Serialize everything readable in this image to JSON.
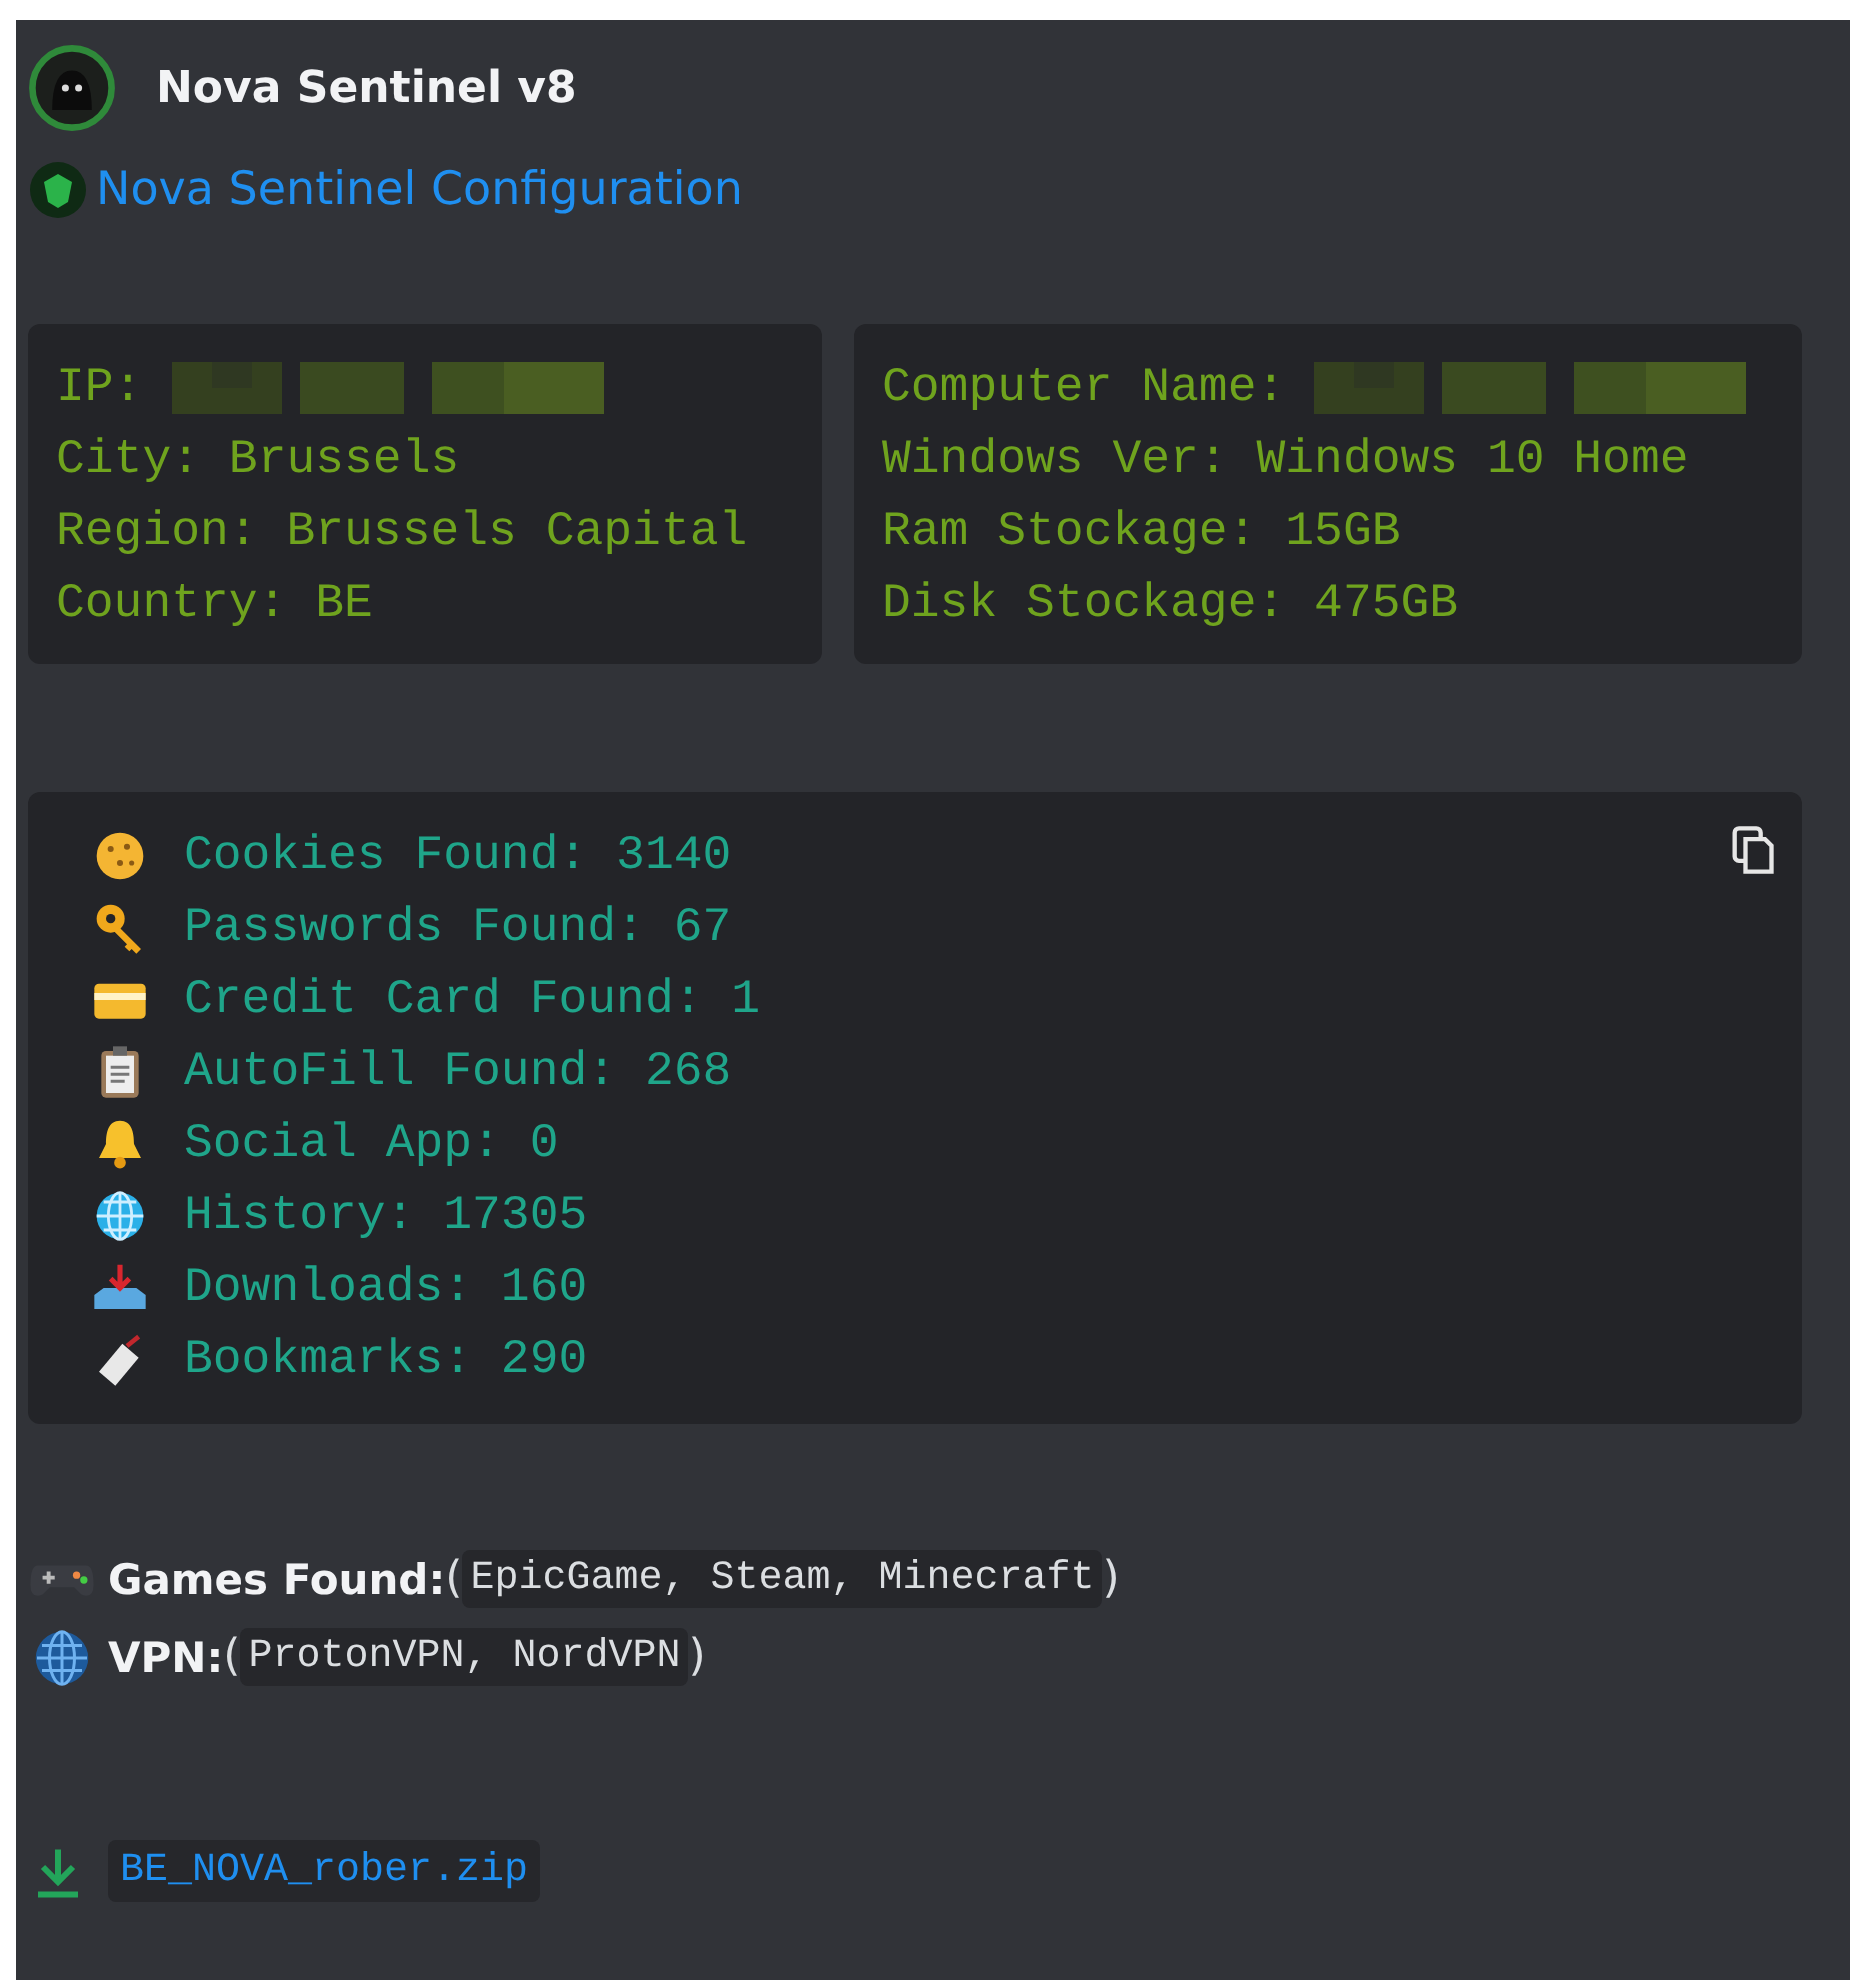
{
  "author": {
    "name": "Nova Sentinel v8"
  },
  "title": {
    "text": "Nova Sentinel Configuration"
  },
  "info_blocks": [
    {
      "lines": [
        {
          "text": "IP: ",
          "redacted": true
        },
        {
          "text": "City: Brussels",
          "redacted": false
        },
        {
          "text": "Region: Brussels Capital",
          "redacted": false
        },
        {
          "text": "Country: BE",
          "redacted": false
        }
      ]
    },
    {
      "lines": [
        {
          "text": "Computer Name: ",
          "redacted": true
        },
        {
          "text": "Windows Ver: Windows 10 Home",
          "redacted": false
        },
        {
          "text": "Ram Stockage: 15GB",
          "redacted": false
        },
        {
          "text": "Disk Stockage: 475GB",
          "redacted": false
        }
      ]
    }
  ],
  "stats": [
    {
      "text": "Cookies Found: 3140"
    },
    {
      "text": "Passwords Found: 67"
    },
    {
      "text": "Credit Card Found: 1"
    },
    {
      "text": "AutoFill Found: 268"
    },
    {
      "text": "Social App: 0"
    },
    {
      "text": "History: 17305"
    },
    {
      "text": "Downloads: 160"
    },
    {
      "text": "Bookmarks: 290"
    }
  ],
  "fields": [
    {
      "label": "Games Found:",
      "open": "(",
      "value": "EpicGame, Steam, Minecraft",
      "close": ")"
    },
    {
      "label": "VPN:",
      "open": "(",
      "value": "ProtonVPN, NordVPN",
      "close": ")"
    }
  ],
  "attachment": {
    "filename": "BE_NOVA_rober.zip"
  }
}
